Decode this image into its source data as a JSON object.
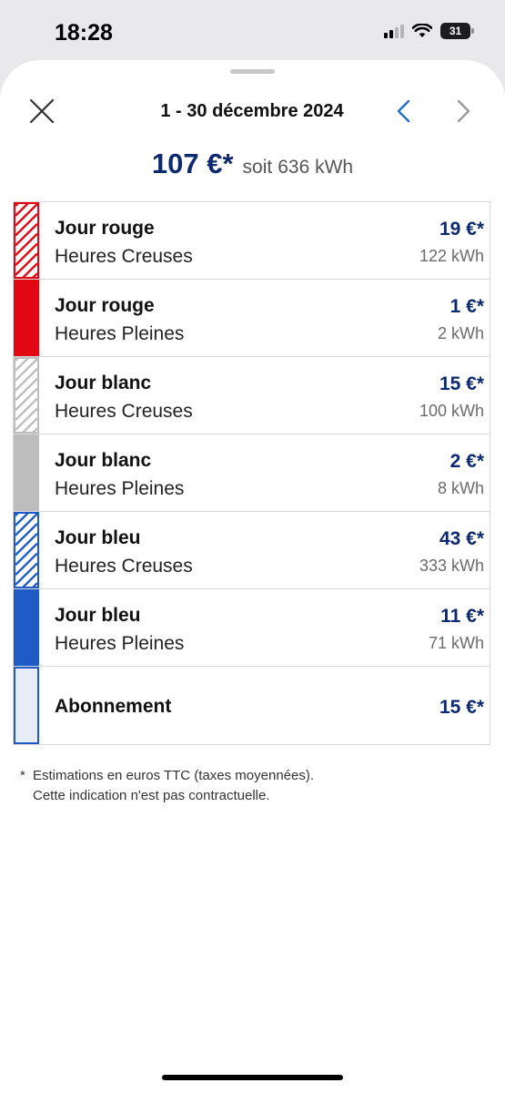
{
  "status_bar": {
    "time": "18:28",
    "battery": "31"
  },
  "header": {
    "period": "1 - 30 décembre 2024",
    "close_icon": "close-icon",
    "prev_icon": "chevron-left-icon",
    "next_icon": "chevron-right-icon",
    "accent_color": "#1f6fd0"
  },
  "summary": {
    "amount": "107 €*",
    "soit": "soit",
    "energy": "636 kWh"
  },
  "rows": [
    {
      "title": "Jour rouge",
      "subtitle": "Heures Creuses",
      "price": "19 €*",
      "energy": "122 kWh",
      "color": "#e30613",
      "pattern": "hatched"
    },
    {
      "title": "Jour rouge",
      "subtitle": "Heures Pleines",
      "price": "1 €*",
      "energy": "2 kWh",
      "color": "#e30613",
      "pattern": "solid"
    },
    {
      "title": "Jour blanc",
      "subtitle": "Heures Creuses",
      "price": "15 €*",
      "energy": "100 kWh",
      "color": "#bdbdbd",
      "pattern": "hatched"
    },
    {
      "title": "Jour blanc",
      "subtitle": "Heures Pleines",
      "price": "2 €*",
      "energy": "8 kWh",
      "color": "#bdbdbd",
      "pattern": "solid"
    },
    {
      "title": "Jour bleu",
      "subtitle": "Heures Creuses",
      "price": "43 €*",
      "energy": "333 kWh",
      "color": "#1f5bc6",
      "pattern": "hatched"
    },
    {
      "title": "Jour bleu",
      "subtitle": "Heures Pleines",
      "price": "11 €*",
      "energy": "71 kWh",
      "color": "#1f5bc6",
      "pattern": "solid"
    },
    {
      "title": "Abonnement",
      "price": "15 €*",
      "color": "#1f5bc6",
      "pattern": "outlined"
    }
  ],
  "footnote": {
    "star": "*",
    "line1": "Estimations en euros TTC (taxes moyennées).",
    "line2": "Cette indication n'est pas contractuelle."
  }
}
